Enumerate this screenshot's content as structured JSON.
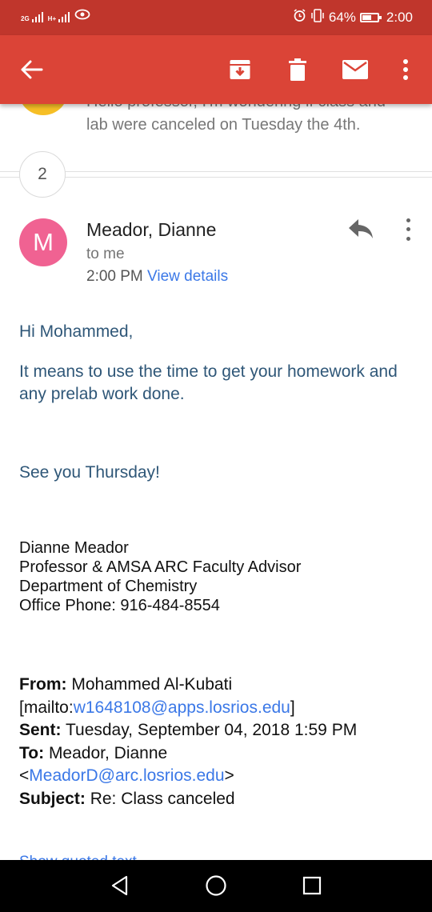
{
  "status_bar": {
    "network_1": "2G",
    "network_2": "H+",
    "battery_percent": "64%",
    "battery_level": 0.64,
    "time": "2:00",
    "icons": [
      "signal-icon",
      "signal-icon",
      "eye-icon",
      "alarm-icon",
      "vibrate-icon",
      "battery-icon"
    ]
  },
  "app_bar": {
    "icons": [
      "back-arrow-icon",
      "archive-icon",
      "trash-icon",
      "mail-icon",
      "more-vert-icon"
    ]
  },
  "previous_message": {
    "snippet_line1": "Hello professor, I'm wondering if class and",
    "snippet_line2": "lab were canceled on Tuesday the 4th."
  },
  "collapsed_count": "2",
  "message": {
    "avatar_letter": "M",
    "sender": "Meador, Dianne",
    "recipient": "to me",
    "time": "2:00 PM",
    "view_details": "View details",
    "greeting": "Hi Mohammed,",
    "paragraph": "It means to use the time to get your homework and any prelab work done.",
    "closing": "See you Thursday!",
    "signature": {
      "name": "Dianne Meador",
      "title": "Professor & AMSA ARC Faculty Advisor",
      "department": "Department of Chemistry",
      "phone": "Office Phone:  916-484-8554"
    },
    "quoted_header": {
      "from_label": "From:",
      "from_name": "Mohammed Al-Kubati",
      "mailto_prefix": "[mailto:",
      "from_email": "w1648108@apps.losrios.edu",
      "mailto_suffix": "]",
      "sent_label": "Sent:",
      "sent_value": "Tuesday, September 04, 2018 1:59 PM",
      "to_label": "To:",
      "to_name": "Meador, Dianne",
      "to_email_prefix": "<",
      "to_email": "MeadorD@arc.losrios.edu",
      "to_email_suffix": ">",
      "subject_label": "Subject:",
      "subject_value": "Re: Class canceled"
    },
    "show_quoted": "Show quoted text"
  },
  "nav_bar": {
    "icons": [
      "back-triangle-icon",
      "home-circle-icon",
      "recents-square-icon"
    ]
  },
  "colors": {
    "status_bar": "#c0362c",
    "app_bar": "#db4437",
    "avatar": "#f06292",
    "prev_avatar": "#f6bf26",
    "link": "#3b78e7",
    "body_text": "#2f5778"
  }
}
